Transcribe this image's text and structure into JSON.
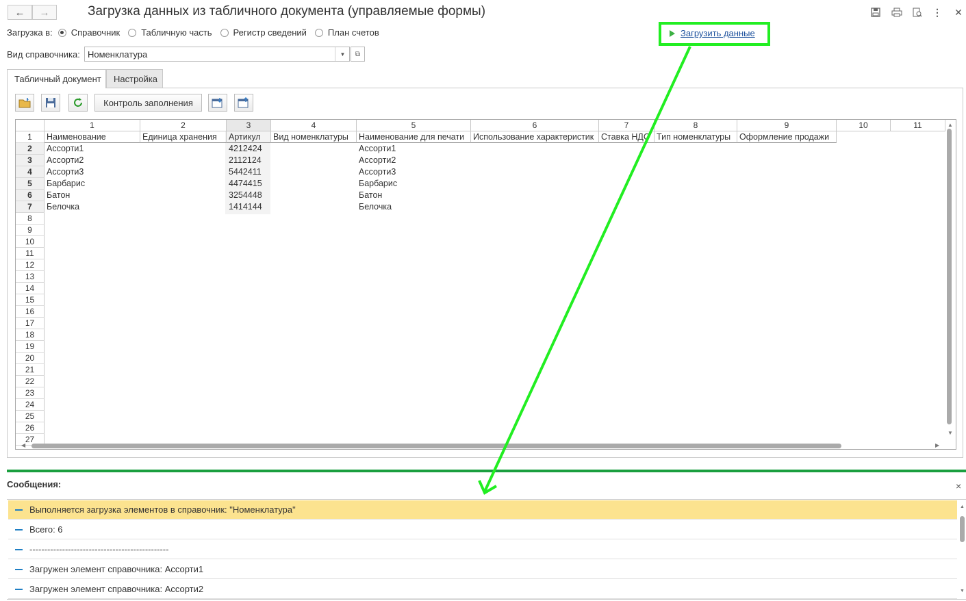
{
  "window": {
    "title": "Загрузка данных из табличного документа (управляемые формы)",
    "nav_back": "←",
    "nav_forward": "→",
    "icons": [
      "save-icon",
      "print-icon",
      "preview-icon",
      "more-icon",
      "close-icon"
    ]
  },
  "load_to": {
    "label": "Загрузка в:",
    "options": [
      "Справочник",
      "Табличную часть",
      "Регистр сведений",
      "План счетов"
    ],
    "selected": "Справочник"
  },
  "catalog_type": {
    "label": "Вид справочника:",
    "value": "Номенклатура"
  },
  "load_link": "Загрузить данные",
  "tabs": [
    "Табличный документ",
    "Настройка"
  ],
  "toolbar": {
    "control_button": "Контроль заполнения"
  },
  "grid": {
    "col_numbers": [
      "1",
      "2",
      "3",
      "4",
      "5",
      "6",
      "7",
      "8",
      "9",
      "10",
      "11"
    ],
    "headers": [
      "Наименование",
      "Единица хранения",
      "Артикул",
      "Вид номенклатуры",
      "Наименование для печати",
      "Использование характеристик",
      "Ставка НДС",
      "Тип номенклатуры",
      "Оформление продажи"
    ],
    "rows": [
      [
        "Ассорти1",
        "",
        "4212424",
        "",
        "Ассорти1"
      ],
      [
        "Ассорти2",
        "",
        "2112124",
        "",
        "Ассорти2"
      ],
      [
        "Ассорти3",
        "",
        "5442411",
        "",
        "Ассорти3"
      ],
      [
        "Барбарис",
        "",
        "4474415",
        "",
        "Барбарис"
      ],
      [
        "Батон",
        "",
        "3254448",
        "",
        "Батон"
      ],
      [
        "Белочка",
        "",
        "1414144",
        "",
        "Белочка"
      ]
    ],
    "row_numbers": [
      "1",
      "2",
      "3",
      "4",
      "5",
      "6",
      "7",
      "8",
      "9",
      "10",
      "11",
      "12",
      "13",
      "14",
      "15",
      "16",
      "17",
      "18",
      "19",
      "20",
      "21",
      "22",
      "23",
      "24",
      "25",
      "26",
      "27"
    ]
  },
  "messages": {
    "title": "Сообщения:",
    "close": "×",
    "items": [
      "Выполняется загрузка элементов в справочник: \"Номенклатура\"",
      "Всего: 6",
      "-----------------------------------------------",
      "Загружен элемент справочника: Ассорти1",
      "Загружен элемент справочника: Ассорти2"
    ]
  },
  "colors": {
    "annotation_green": "#22ee22",
    "separator_green": "#1a9f3f",
    "highlight_row": "#fce38f",
    "link": "#1a4f9c"
  }
}
